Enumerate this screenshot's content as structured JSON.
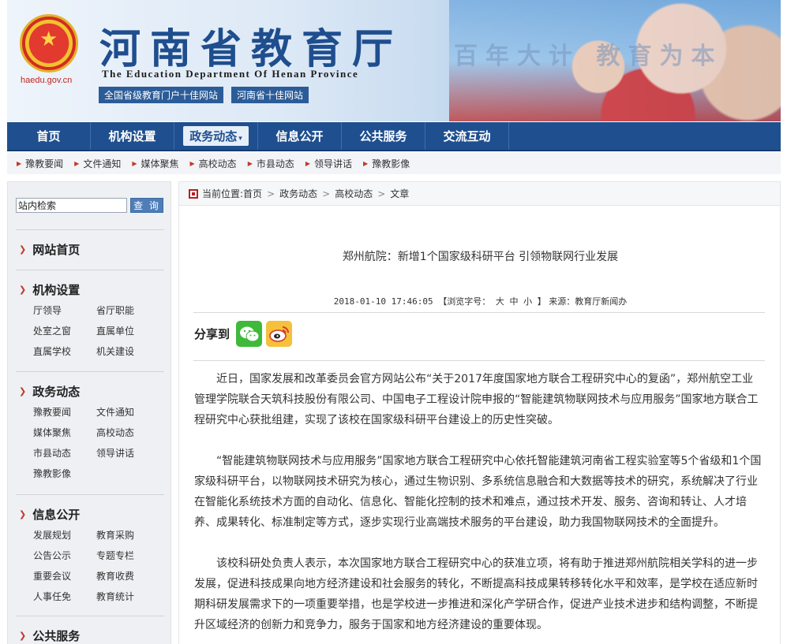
{
  "header": {
    "title": "河南省教育厅",
    "title_en": "The Education Department Of Henan Province",
    "domain": "haedu.gov.cn",
    "slogan": "百年大计 教育为本",
    "badges": [
      "全国省级教育门户十佳网站",
      "河南省十佳网站"
    ]
  },
  "mainnav": {
    "items": [
      "首页",
      "机构设置",
      "政务动态",
      "信息公开",
      "公共服务",
      "交流互动"
    ],
    "active_index": 2
  },
  "subnav": {
    "items": [
      "豫教要闻",
      "文件通知",
      "媒体聚焦",
      "高校动态",
      "市县动态",
      "领导讲话",
      "豫教影像"
    ]
  },
  "sidebar": {
    "search": {
      "value": "站内检索",
      "button": "查 询"
    },
    "home": "网站首页",
    "sections": [
      {
        "title": "机构设置",
        "items": [
          "厅领导",
          "省厅职能",
          "处室之窗",
          "直属单位",
          "直属学校",
          "机关建设"
        ]
      },
      {
        "title": "政务动态",
        "items": [
          "豫教要闻",
          "文件通知",
          "媒体聚焦",
          "高校动态",
          "市县动态",
          "领导讲话",
          "豫教影像"
        ]
      },
      {
        "title": "信息公开",
        "items": [
          "发展规划",
          "教育采购",
          "公告公示",
          "专题专栏",
          "重要会议",
          "教育收费",
          "人事任免",
          "教育统计"
        ]
      },
      {
        "title": "公共服务",
        "items": []
      }
    ]
  },
  "content": {
    "breadcrumb": {
      "label": "当前位置:",
      "items": [
        "首页",
        "政务动态",
        "高校动态",
        "文章"
      ]
    },
    "title": "郑州航院：新增1个国家级科研平台 引领物联网行业发展",
    "meta": {
      "datetime": "2018-01-10 17:46:05",
      "font_label": "【浏览字号：",
      "sizes": [
        "大",
        "中",
        "小"
      ],
      "source": "】 来源：教育厅新闻办"
    },
    "share_label": "分享到",
    "paragraphs": [
      "近日，国家发展和改革委员会官方网站公布“关于2017年度国家地方联合工程研究中心的复函”，郑州航空工业管理学院联合天筑科技股份有限公司、中国电子工程设计院申报的“智能建筑物联网技术与应用服务”国家地方联合工程研究中心获批组建，实现了该校在国家级科研平台建设上的历史性突破。",
      "“智能建筑物联网技术与应用服务”国家地方联合工程研究中心依托智能建筑河南省工程实验室等5个省级和1个国家级科研平台，以物联网技术研究为核心，通过生物识别、多系统信息融合和大数据等技术的研究，系统解决了行业在智能化系统技术方面的自动化、信息化、智能化控制的技术和难点，通过技术开发、服务、咨询和转让、人才培养、成果转化、标准制定等方式，逐步实现行业高端技术服务的平台建设，助力我国物联网技术的全面提升。",
      "该校科研处负责人表示，本次国家地方联合工程研究中心的获准立项，将有助于推进郑州航院相关学科的进一步发展，促进科技成果向地方经济建设和社会服务的转化，不断提高科技成果转移转化水平和效率，是学校在适应新时期科研发展需求下的一项重要举措，也是学校进一步推进和深化产学研合作，促进产业技术进步和结构调整，不断提升区域经济的创新力和竞争力，服务于国家和地方经济建设的重要体现。"
    ]
  },
  "colors": {
    "nav": "#1f4f8f",
    "accent_red": "#c0392b",
    "title_blue": "#1f4e8e"
  },
  "icons": [
    "national-emblem-icon",
    "wechat-icon",
    "weibo-icon",
    "arrow-right-icon",
    "chevron-right-icon"
  ]
}
